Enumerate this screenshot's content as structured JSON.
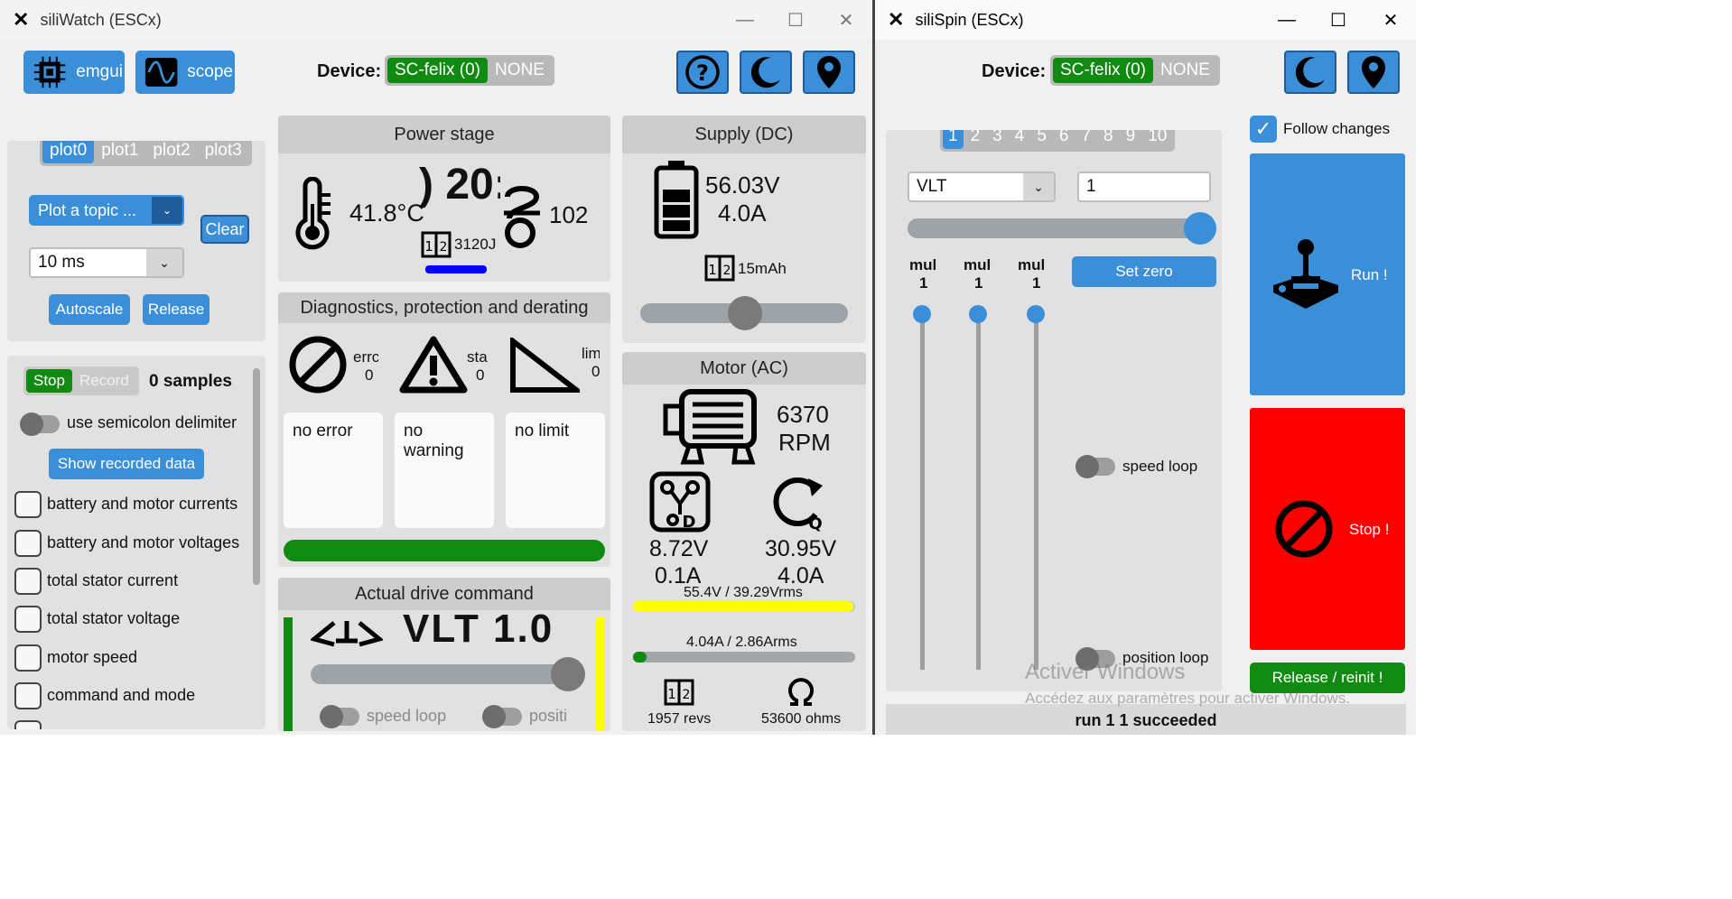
{
  "left_window": {
    "title": "siliWatch (ESCx)",
    "toolbar": {
      "emgui_label": "emgui",
      "scope_label": "scope"
    },
    "device": {
      "label": "Device:",
      "options": [
        "SC-felix (0)",
        "NONE"
      ],
      "selected": "SC-felix (0)"
    },
    "plots": {
      "tabs": [
        "plot0",
        "plot1",
        "plot2",
        "plot3"
      ],
      "selected_tab": "plot0",
      "topic_placeholder": "Plot a topic ...",
      "period": "10 ms",
      "clear_label": "Clear",
      "autoscale_label": "Autoscale",
      "release_label": "Release"
    },
    "recorder": {
      "stop_label": "Stop",
      "record_label": "Record",
      "samples": "0 samples",
      "semicolon_label": "use semicolon delimiter",
      "show_label": "Show recorded data",
      "topics": [
        "battery and motor currents",
        "battery and motor voltages",
        "total stator current",
        "total stator voltage",
        "motor speed",
        "command and mode"
      ]
    },
    "power_stage": {
      "title": "Power stage",
      "temperature": "41.8°C",
      "partial_value": ") 20:",
      "energy": "3120J",
      "freq": "102"
    },
    "diagnostics": {
      "title": "Diagnostics, protection and derating",
      "error_label": "errc",
      "error_value": "0",
      "status_label": "sta",
      "status_value": "0",
      "limit_label": "lim",
      "limit_value": "0",
      "error_text": "no error",
      "warning_text": "no warning",
      "limit_text": "no limit"
    },
    "drive": {
      "title": "Actual drive command",
      "command": "VLT 1.0",
      "speed_loop_label": "speed loop",
      "position_label": "positi"
    },
    "supply": {
      "title": "Supply (DC)",
      "voltage": "56.03V",
      "current": "4.0A",
      "charge": "15mAh",
      "slider_level": 0.5
    },
    "motor": {
      "title": "Motor (AC)",
      "speed": "6370",
      "speed_unit": "RPM",
      "d_voltage": "8.72V",
      "d_current": "0.1A",
      "q_voltage": "30.95V",
      "q_current": "4.0A",
      "voltage_bar_label": "55.4V / 39.29Vrms",
      "voltage_bar_level": 0.99,
      "current_bar_label": "4.04A / 2.86Arms",
      "current_bar_level": 0.04,
      "revs": "1957 revs",
      "ohms": "53600 ohms"
    }
  },
  "right_window": {
    "title": "siliSpin (ESCx)",
    "device": {
      "label": "Device:",
      "options": [
        "SC-felix (0)",
        "NONE"
      ],
      "selected": "SC-felix (0)"
    },
    "pages": [
      "1",
      "2",
      "3",
      "4",
      "5",
      "6",
      "7",
      "8",
      "9",
      "10"
    ],
    "selected_page": "1",
    "mode": "VLT",
    "value": "1",
    "main_slider_level": 1.0,
    "mul_labels": [
      "mul",
      "mul",
      "mul"
    ],
    "mul_values": [
      "1",
      "1",
      "1"
    ],
    "set_zero_label": "Set zero",
    "speed_loop_label": "speed loop",
    "position_loop_label": "position loop",
    "follow_label": "Follow changes",
    "run_label": "Run !",
    "stop_label": "Stop !",
    "release_label": "Release / reinit !",
    "status": "run 1 1 succeeded",
    "watermark_title": "Activer Windows",
    "watermark_sub": "Accédez aux paramètres pour activer Windows."
  },
  "colors": {
    "accent": "#3a8fd8",
    "ok": "#118a11",
    "danger": "#ff0000",
    "warn": "#ffff00",
    "pwm": "#0000ff"
  }
}
